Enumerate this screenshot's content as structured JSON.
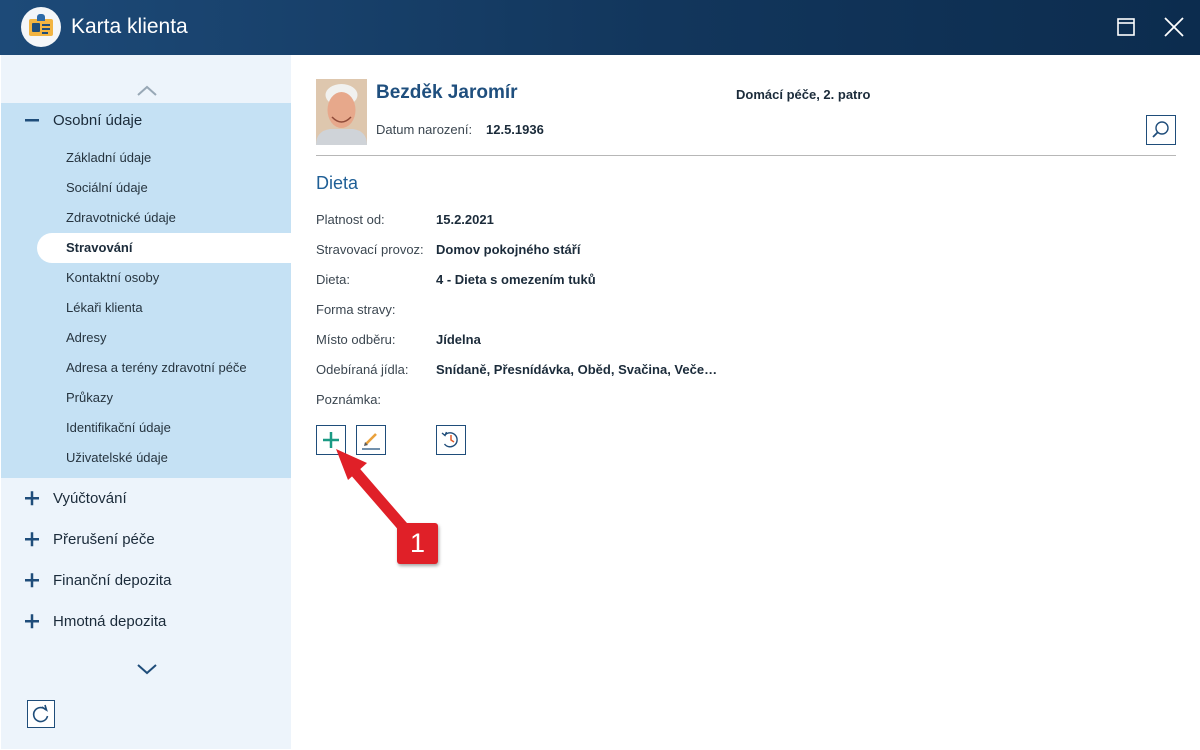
{
  "window": {
    "title": "Karta klienta",
    "icons": {
      "app": "client-card-icon",
      "maximize": "maximize-icon",
      "close": "close-icon"
    }
  },
  "sidebar": {
    "expanded_group": {
      "label": "Osobní údaje",
      "items": [
        {
          "label": "Základní údaje",
          "active": false
        },
        {
          "label": "Sociální údaje",
          "active": false
        },
        {
          "label": "Zdravotnické údaje",
          "active": false
        },
        {
          "label": "Stravování",
          "active": true
        },
        {
          "label": "Kontaktní osoby",
          "active": false
        },
        {
          "label": "Lékaři klienta",
          "active": false
        },
        {
          "label": "Adresy",
          "active": false
        },
        {
          "label": "Adresa a terény zdravotní péče",
          "active": false
        },
        {
          "label": "Průkazy",
          "active": false
        },
        {
          "label": "Identifikační údaje",
          "active": false
        },
        {
          "label": "Uživatelské údaje",
          "active": false
        }
      ]
    },
    "collapsed_groups": [
      {
        "label": "Vyúčtování"
      },
      {
        "label": "Přerušení péče"
      },
      {
        "label": "Finanční depozita"
      },
      {
        "label": "Hmotná depozita"
      }
    ],
    "icons": {
      "scroll_up": "chevron-up-icon",
      "scroll_down": "chevron-down-icon",
      "refresh": "refresh-icon"
    }
  },
  "client": {
    "name": "Bezděk Jaromír",
    "location": "Domácí péče, 2. patro",
    "dob_label": "Datum narození:",
    "dob_value": "12.5.1936"
  },
  "diet": {
    "section_title": "Dieta",
    "fields": [
      {
        "label": "Platnost od:",
        "value": "15.2.2021"
      },
      {
        "label": "Stravovací provoz:",
        "value": "Domov pokojného stáří"
      },
      {
        "label": "Dieta:",
        "value": "4 - Dieta s omezením tuků"
      },
      {
        "label": "Forma stravy:",
        "value": ""
      },
      {
        "label": "Místo odběru:",
        "value": "Jídelna"
      },
      {
        "label": "Odebíraná jídla:",
        "value": "Snídaně, Přesnídávka, Oběd, Svačina, Veče…"
      },
      {
        "label": "Poznámka:",
        "value": ""
      }
    ],
    "toolbar_icons": [
      "add-icon",
      "edit-icon",
      "history-icon"
    ]
  },
  "annotation": {
    "label": "1",
    "color": "#e02028"
  },
  "colors": {
    "accent": "#1f4d7a",
    "title_bar": "#12365c",
    "sidebar_bg": "#edf4fb",
    "sidebar_selected_group": "#c5e1f4",
    "add_icon": "#1a9a84"
  }
}
